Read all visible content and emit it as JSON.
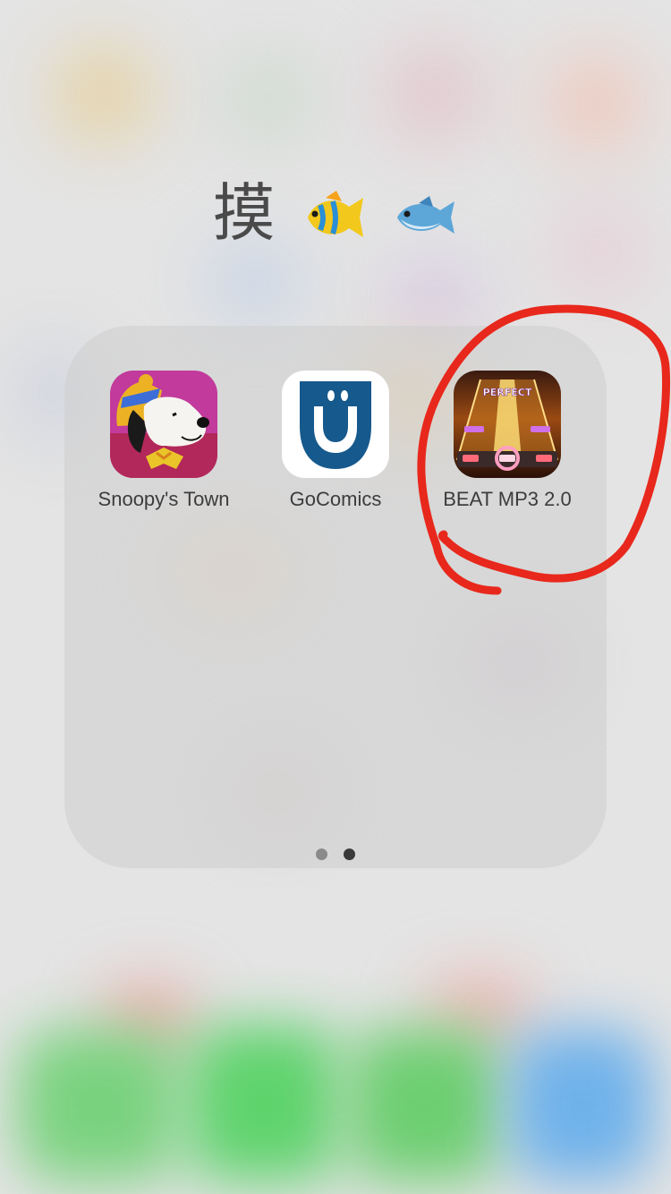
{
  "folder": {
    "title": "摸",
    "title_emoji": [
      "tropical-fish",
      "fish"
    ],
    "apps": [
      {
        "name": "Snoopy's Town",
        "icon": "snoopy-icon"
      },
      {
        "name": "GoComics",
        "icon": "gocomics-icon"
      },
      {
        "name": "BEAT MP3 2.0",
        "icon": "beat-mp3-icon",
        "icon_text": "PERFECT"
      }
    ],
    "page_indicator": {
      "total": 2,
      "current": 2
    }
  },
  "annotation": {
    "shape": "hand-drawn circle around BEAT MP3 2.0",
    "color": "#e8281c"
  },
  "colors": {
    "gocomics_blue": "#16598c",
    "snoopy_bg": "#c23a9c",
    "beat_bg": "#7a3a10",
    "dot_inactive": "#8a8a8a",
    "dot_active": "#3a3a3a"
  }
}
